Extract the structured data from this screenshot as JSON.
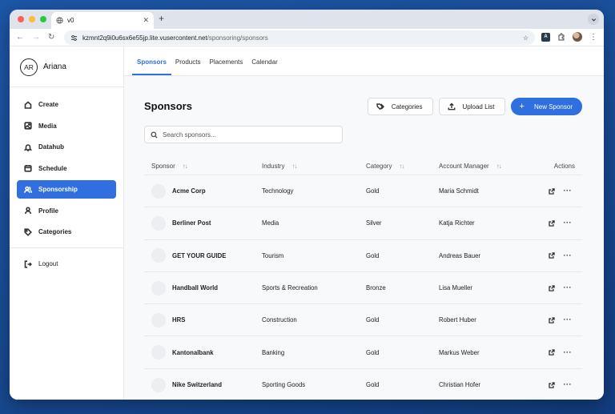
{
  "browser": {
    "tab_title": "v0",
    "url_host": "kzmnt2q9i0u6sx6e55jp.lite.vusercontent.net",
    "url_path": "/sponsoring/sponsors",
    "colors": {
      "close": "#ff5f57",
      "minimize": "#febc2e",
      "maximize": "#28c840"
    }
  },
  "user": {
    "initials": "AR",
    "name": "Ariana"
  },
  "sidebar": {
    "items": [
      {
        "label": "Create",
        "icon": "home-icon"
      },
      {
        "label": "Media",
        "icon": "image-icon"
      },
      {
        "label": "Datahub",
        "icon": "bell-icon"
      },
      {
        "label": "Schedule",
        "icon": "calendar-icon"
      },
      {
        "label": "Sponsorship",
        "icon": "users-icon",
        "active": true
      },
      {
        "label": "Profile",
        "icon": "user-icon"
      },
      {
        "label": "Categories",
        "icon": "tag-icon"
      }
    ],
    "logout": "Logout"
  },
  "subnav": {
    "tabs": [
      {
        "label": "Sponsors",
        "active": true
      },
      {
        "label": "Products"
      },
      {
        "label": "Placements"
      },
      {
        "label": "Calendar"
      }
    ]
  },
  "page": {
    "title": "Sponsors",
    "categories_button": "Categories",
    "upload_button": "Upload List",
    "new_button": "New Sponsor",
    "accent": "#2f6fe0"
  },
  "search": {
    "placeholder": "Search sponsors..."
  },
  "table": {
    "headers": [
      "Sponsor",
      "Industry",
      "Category",
      "Account Manager",
      "Actions"
    ],
    "rows": [
      {
        "sponsor": "Acme Corp",
        "industry": "Technology",
        "category": "Gold",
        "manager": "Maria Schmidt"
      },
      {
        "sponsor": "Berliner Post",
        "industry": "Media",
        "category": "Silver",
        "manager": "Katja Richter"
      },
      {
        "sponsor": "GET YOUR GUIDE",
        "industry": "Tourism",
        "category": "Gold",
        "manager": "Andreas Bauer"
      },
      {
        "sponsor": "Handball World",
        "industry": "Sports & Recreation",
        "category": "Bronze",
        "manager": "Lisa Mueller"
      },
      {
        "sponsor": "HRS",
        "industry": "Construction",
        "category": "Gold",
        "manager": "Robert Huber"
      },
      {
        "sponsor": "Kantonalbank",
        "industry": "Banking",
        "category": "Gold",
        "manager": "Markus Weber"
      },
      {
        "sponsor": "Nike Switzerland",
        "industry": "Sporting Goods",
        "category": "Gold",
        "manager": "Christian Hofer"
      }
    ]
  }
}
